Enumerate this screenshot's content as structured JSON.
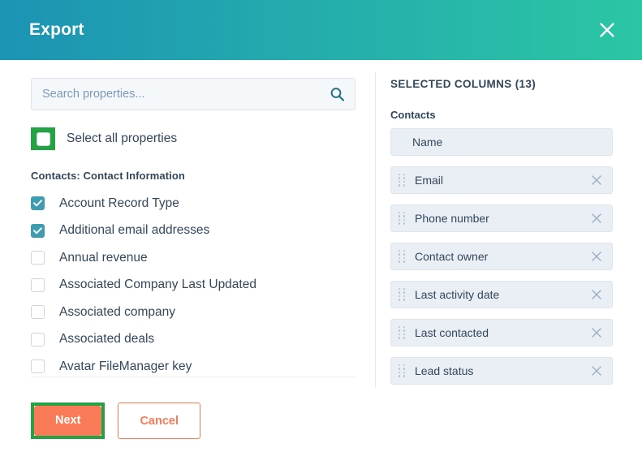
{
  "header": {
    "title": "Export",
    "close_icon": "close-icon"
  },
  "search": {
    "placeholder": "Search properties...",
    "value": "",
    "icon": "search-icon"
  },
  "select_all": {
    "label": "Select all properties",
    "checked": false,
    "highlight_color": "#25a244"
  },
  "left_panel": {
    "group_title": "Contacts: Contact Information",
    "properties": [
      {
        "label": "Account Record Type",
        "checked": true
      },
      {
        "label": "Additional email addresses",
        "checked": true
      },
      {
        "label": "Annual revenue",
        "checked": false
      },
      {
        "label": "Associated Company Last Updated",
        "checked": false
      },
      {
        "label": "Associated company",
        "checked": false
      },
      {
        "label": "Associated deals",
        "checked": false
      },
      {
        "label": "Avatar FileManager key",
        "checked": false
      }
    ]
  },
  "right_panel": {
    "header": "SELECTED COLUMNS (13)",
    "group_label": "Contacts",
    "columns": [
      {
        "label": "Name",
        "removable": false,
        "draggable": false
      },
      {
        "label": "Email",
        "removable": true,
        "draggable": true
      },
      {
        "label": "Phone number",
        "removable": true,
        "draggable": true
      },
      {
        "label": "Contact owner",
        "removable": true,
        "draggable": true
      },
      {
        "label": "Last activity date",
        "removable": true,
        "draggable": true
      },
      {
        "label": "Last contacted",
        "removable": true,
        "draggable": true
      },
      {
        "label": "Lead status",
        "removable": true,
        "draggable": true
      }
    ]
  },
  "footer": {
    "next_label": "Next",
    "cancel_label": "Cancel",
    "next_color": "#fa7b58",
    "next_highlight_color": "#25a244",
    "cancel_color": "#fa7b58"
  },
  "colors": {
    "header_gradient_start": "#1c93b4",
    "header_gradient_end": "#2bc6a4",
    "checkbox_checked": "#3d9cb0",
    "text": "#33475b",
    "column_row_bg": "#eaeff5"
  }
}
